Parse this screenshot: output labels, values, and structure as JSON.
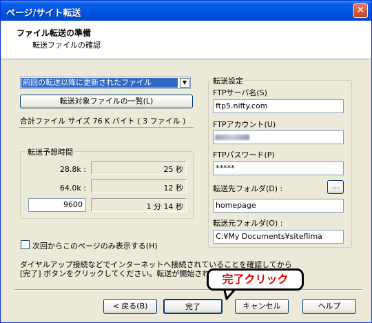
{
  "window": {
    "title": "ページ/サイト転送",
    "close_glyph": "✕"
  },
  "header": {
    "title": "ファイル転送の準備",
    "subtitle": "転送ファイルの確認"
  },
  "left": {
    "combo_value": "前回の転送以降に更新されたファイル",
    "list_button": "転送対象ファイルの一覧(L)",
    "total_label": "合計ファイル サイズ",
    "total_value": "76 K バイト ( 3 ファイル )",
    "estimate": {
      "legend": "転送予想時間",
      "rows": [
        {
          "speed": "28.8k :",
          "time": "25 秒"
        },
        {
          "speed": "64.0k :",
          "time": "12 秒"
        },
        {
          "speed": "9600",
          "time": "1 分 14 秒"
        }
      ]
    },
    "checkbox_label": "次回からこのページのみ表示する(H)"
  },
  "right": {
    "legend": "転送設定",
    "ftp_server_label": "FTPサーバ名(S)",
    "ftp_server_value": "ftp5.nifty.com",
    "ftp_account_label": "FTPアカウント(U)",
    "ftp_password_label": "FTPパスワード(P)",
    "ftp_password_value": "*****",
    "dest_folder_label": "転送先フォルダ(D) :",
    "browse_button": "...",
    "dest_folder_value": "homepage",
    "src_folder_label": "転送元フォルダ(O) :",
    "src_folder_value": "C:¥My Documents¥siteflima"
  },
  "footer": {
    "info_line1": "ダイヤルアップ接続などでインターネットへ接続されていることを確認してから",
    "info_line2": "[完了] ボタンをクリックしてください。転送が開始されます。",
    "back_button": "< 戻る(B)",
    "finish_button": "完了",
    "cancel_button": "キャンセル",
    "help_button": "ヘルプ"
  },
  "annotation": {
    "callout_text": "完了クリック",
    "callout_color": "#E00000"
  }
}
